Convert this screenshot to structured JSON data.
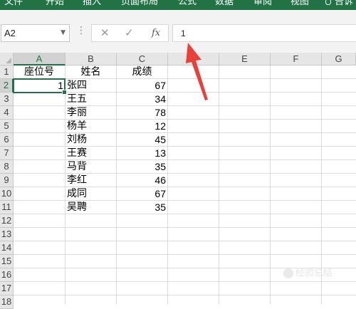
{
  "ribbon": {
    "tabs": [
      "文件",
      "开始",
      "插入",
      "页面布局",
      "公式",
      "数据",
      "审阅",
      "视图",
      "告诉"
    ],
    "color": "#217346"
  },
  "formula_bar": {
    "name_box": "A2",
    "cancel_icon": "✕",
    "enter_icon": "✓",
    "fx_label": "fx",
    "value": "1"
  },
  "columns": [
    "A",
    "B",
    "C",
    "D",
    "E",
    "F",
    "G"
  ],
  "rows": [
    "1",
    "2",
    "3",
    "4",
    "5",
    "6",
    "7",
    "8",
    "9",
    "10",
    "11",
    "12",
    "13",
    "14",
    "15",
    "16",
    "17",
    "18"
  ],
  "sheet": {
    "headers": [
      "座位号",
      "姓名",
      "成绩"
    ],
    "data": [
      {
        "seat": "1",
        "name": "张四",
        "score": "67"
      },
      {
        "seat": "",
        "name": "王五",
        "score": "34"
      },
      {
        "seat": "",
        "name": "李丽",
        "score": "78"
      },
      {
        "seat": "",
        "name": "杨羊",
        "score": "12"
      },
      {
        "seat": "",
        "name": "刘杨",
        "score": "45"
      },
      {
        "seat": "",
        "name": "王赛",
        "score": "13"
      },
      {
        "seat": "",
        "name": "马背",
        "score": "35"
      },
      {
        "seat": "",
        "name": "李红",
        "score": "46"
      },
      {
        "seat": "",
        "name": "成同",
        "score": "67"
      },
      {
        "seat": "",
        "name": "吴聘",
        "score": "35"
      }
    ]
  },
  "selection": {
    "active_cell": "A2",
    "accent": "#217346"
  },
  "annotation": {
    "arrow_color": "#e8413a"
  },
  "watermark": {
    "text": "经验总结"
  }
}
